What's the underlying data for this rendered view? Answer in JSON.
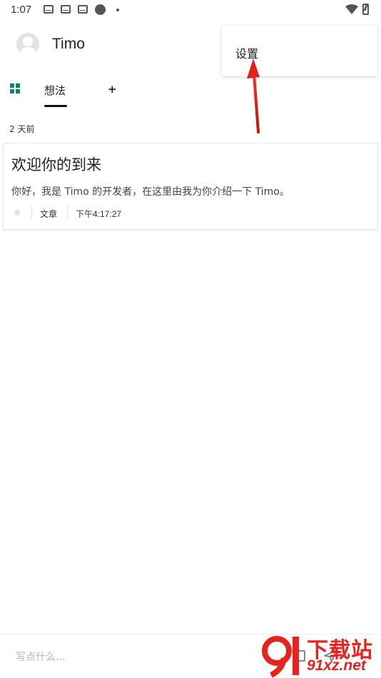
{
  "status_bar": {
    "time": "1:07",
    "icons": [
      "mail-icon",
      "mail-icon",
      "mail-icon",
      "circle-icon",
      "dot-icon",
      "wifi-icon",
      "battery-icon"
    ]
  },
  "header": {
    "username": "Timo"
  },
  "tabs": {
    "active_label": "想法",
    "add_label": "+"
  },
  "menu": {
    "items": [
      "设置"
    ]
  },
  "timeline": {
    "time_ago": "2 天前",
    "posts": [
      {
        "title": "欢迎你的到来",
        "body": "你好，我是 Timo 的开发者，在这里由我为你介绍一下 Timo。",
        "type": "文章",
        "time": "下午4:17:27"
      }
    ]
  },
  "compose": {
    "placeholder": "写点什么...",
    "value": ""
  },
  "watermark": {
    "main": "下载站",
    "sub": "91xz.net"
  },
  "colors": {
    "accent": "#12806b",
    "arrow": "#e0201b",
    "watermark": "#e8231d"
  }
}
